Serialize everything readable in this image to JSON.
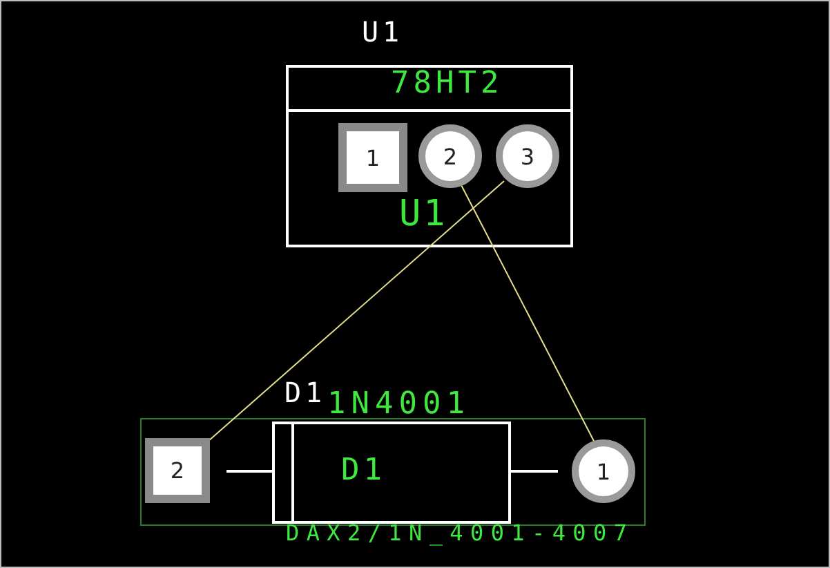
{
  "components": [
    {
      "refdes": "U1",
      "value": "78HT2",
      "label": "U1",
      "pins": [
        {
          "number": "1",
          "kind": "square"
        },
        {
          "number": "2",
          "kind": "round"
        },
        {
          "number": "3",
          "kind": "round"
        }
      ]
    },
    {
      "refdes": "D1",
      "value": "1N4001",
      "label": "D1",
      "footprint": "DAX2/1N_4001-4007",
      "pins": [
        {
          "number": "2",
          "kind": "square"
        },
        {
          "number": "1",
          "kind": "round"
        }
      ]
    }
  ]
}
